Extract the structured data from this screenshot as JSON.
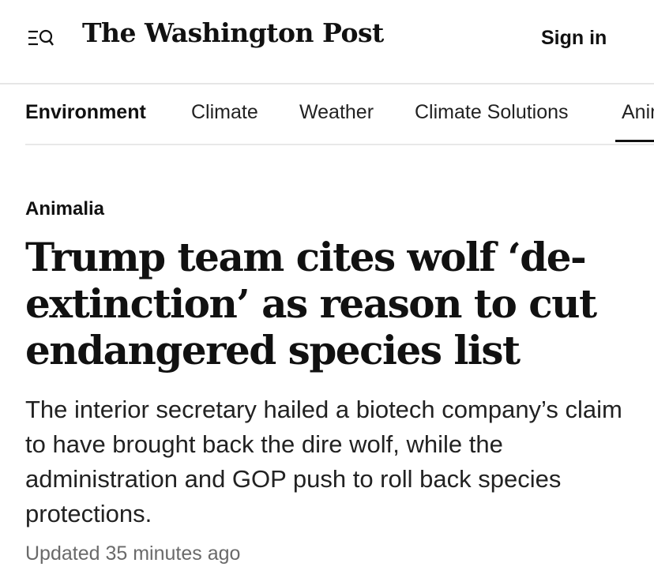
{
  "header": {
    "menu_icon": "menu-search-icon",
    "logo_text": "The Washington Post",
    "sign_in_label": "Sign in"
  },
  "nav": {
    "items": [
      {
        "label": "Environment",
        "active": true
      },
      {
        "label": "Climate"
      },
      {
        "label": "Weather"
      },
      {
        "label": "Climate Solutions"
      },
      {
        "label": "Animalia"
      }
    ]
  },
  "article": {
    "kicker": "Animalia",
    "headline": "Trump team cites wolf ‘de-extinction’ as reason to cut endangered species list",
    "dek": "The interior secretary hailed a biotech company’s claim to have brought back the dire wolf, while the administration and GOP push to roll back species protections.",
    "timestamp": "Updated 35 minutes ago"
  },
  "colors": {
    "text": "#111111",
    "muted": "#6a6a6a",
    "divider": "#e6e6e6"
  }
}
